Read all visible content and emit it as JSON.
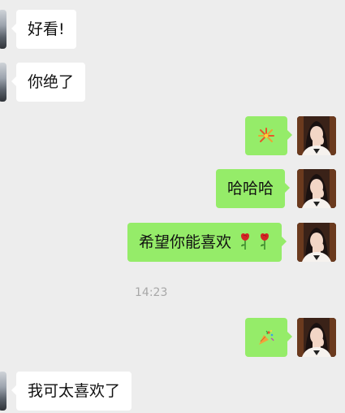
{
  "messages": [
    {
      "side": "left",
      "text": "好看!"
    },
    {
      "side": "left",
      "text": "你绝了"
    },
    {
      "side": "right",
      "emoji": "firework-sticker"
    },
    {
      "side": "right",
      "text": "哈哈哈"
    },
    {
      "side": "right",
      "text": "希望你能喜欢",
      "trailing_icons": [
        "rose-icon",
        "rose-icon"
      ]
    },
    {
      "side": "right",
      "emoji": "party-popper-sticker"
    },
    {
      "side": "left",
      "text": "我可太喜欢了"
    }
  ],
  "timestamp": "14:23",
  "colors": {
    "background": "#ededed",
    "incoming_bubble": "#ffffff",
    "outgoing_bubble": "#95ec69",
    "timestamp_text": "#a7a7a7"
  }
}
